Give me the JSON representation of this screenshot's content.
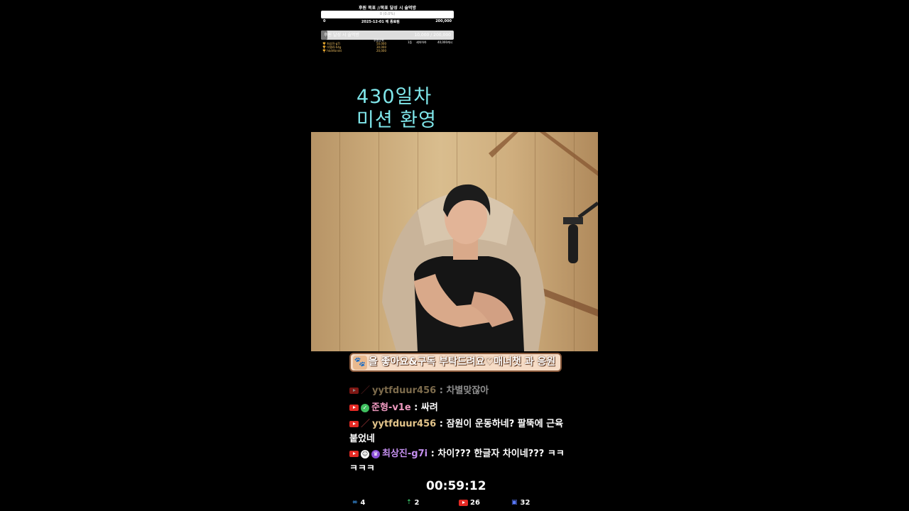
{
  "goal": {
    "title": "후원 목표 //목표 달성 시 술먹방",
    "bar_percent_text": "0 (0.0%)",
    "progress_fraction": 0.0,
    "start": "0",
    "end_date": "2025-12-01 에 종료됨",
    "target": "200,000",
    "bar2_label": "후원 달성 시 술먹방",
    "bar2_amount": "10,000 / 200,000",
    "bar2_fraction": 0.05,
    "col_label": "후원순위",
    "first_label": "1등",
    "first_name": "세하하하",
    "first_amount": "40,000캐시",
    "ranking": [
      {
        "name": "최상진-g7i",
        "amount": "50,000"
      },
      {
        "name": "아델라-h4g",
        "amount": "30,000"
      },
      {
        "name": "hkdrtkrvkt",
        "amount": "20,000"
      }
    ]
  },
  "overlay": {
    "line1": "430일차",
    "line2": "미션 환영"
  },
  "banner": {
    "icon": "paw-icon",
    "text": "을 좋아요&구독 부탁드려요♡매너챗 과 응원"
  },
  "chat": [
    {
      "name": "yytfduur456",
      "sep": " : ",
      "text": "차별맞잖아",
      "badge": "slash"
    },
    {
      "name": "준형-v1e",
      "sep": " : ",
      "text": "싸려",
      "badge": "member"
    },
    {
      "name": "yytfduur456",
      "sep": " : ",
      "text": "잠원이 운동하네? 팔뚝에 근육붙었네",
      "badge": "slash"
    },
    {
      "name": "최상진-g7i",
      "sep": " : ",
      "text": "차이??? 한글자 차이네??? ㅋㅋㅋㅋㅋ",
      "badge": "vip"
    }
  ],
  "timer": "00:59:12",
  "stats": [
    {
      "icon": "link-icon",
      "value": "4",
      "color": "#3fa3ff"
    },
    {
      "icon": "person-up-icon",
      "value": "2",
      "color": "#3fcf6f"
    },
    {
      "icon": "youtube-icon",
      "value": "26",
      "color": "#e52a24"
    },
    {
      "icon": "badge-icon",
      "value": "32",
      "color": "#5b7bff"
    }
  ]
}
